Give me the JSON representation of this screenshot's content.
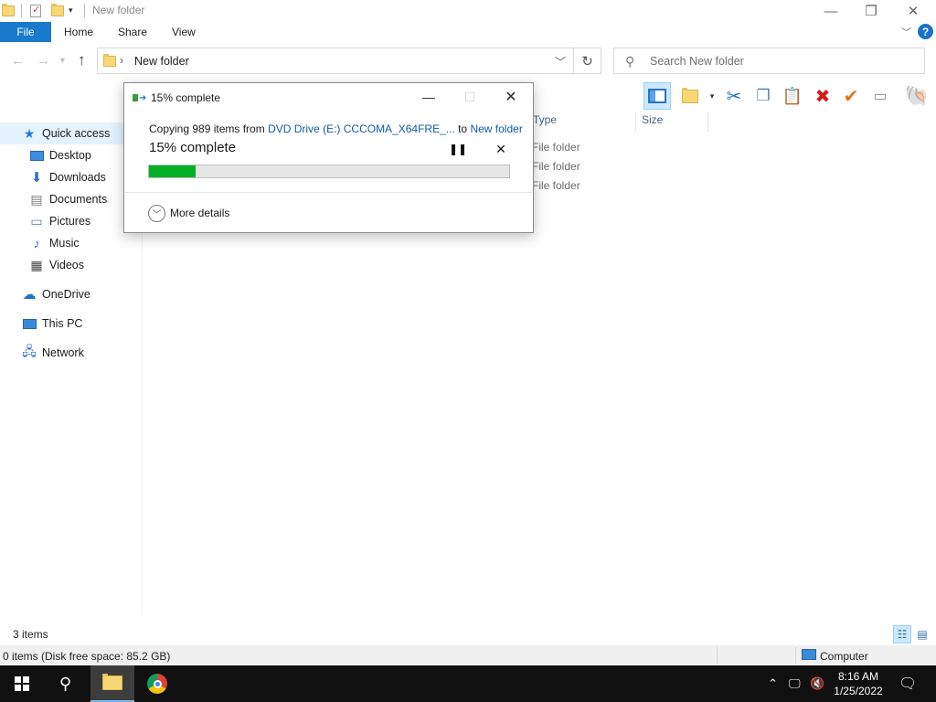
{
  "window": {
    "title": "New folder"
  },
  "icons": {
    "qa_folder": "folder-icon",
    "properties": "properties-icon",
    "minimize": "minimize-icon",
    "maximize": "maximize-icon",
    "close": "close-icon",
    "help": "help-icon"
  },
  "ribbon": {
    "tabs": [
      "File",
      "Home",
      "Share",
      "View"
    ]
  },
  "address": {
    "path": "New folder",
    "search_placeholder": "Search New folder"
  },
  "toolbar": {
    "buttons": [
      "preview-pane",
      "new-folder",
      "cut",
      "copy",
      "paste",
      "delete",
      "rename-check",
      "properties-window",
      "shell-icon"
    ]
  },
  "nav": {
    "quick_access": "Quick access",
    "items": [
      "Desktop",
      "Downloads",
      "Documents",
      "Pictures",
      "Music",
      "Videos"
    ],
    "onedrive": "OneDrive",
    "this_pc": "This PC",
    "network": "Network"
  },
  "list": {
    "columns": {
      "type": "Type",
      "size": "Size"
    },
    "rows": [
      {
        "type": "File folder"
      },
      {
        "type": "File folder"
      },
      {
        "type": "File folder"
      }
    ]
  },
  "status": {
    "item_count": "3 items",
    "selection": "0 items (Disk free space: 85.2 GB)",
    "location": "Computer"
  },
  "taskbar": {
    "time": "8:16 AM",
    "date": "1/25/2022"
  },
  "dialog": {
    "title": "15% complete",
    "copy_prefix": "Copying 989 items from ",
    "source": "DVD Drive (E:) CCCOMA_X64FRE_...",
    "to_text": " to ",
    "destination": "New folder",
    "percent_label": "15% complete",
    "progress": 0.13,
    "more_details": "More details"
  }
}
